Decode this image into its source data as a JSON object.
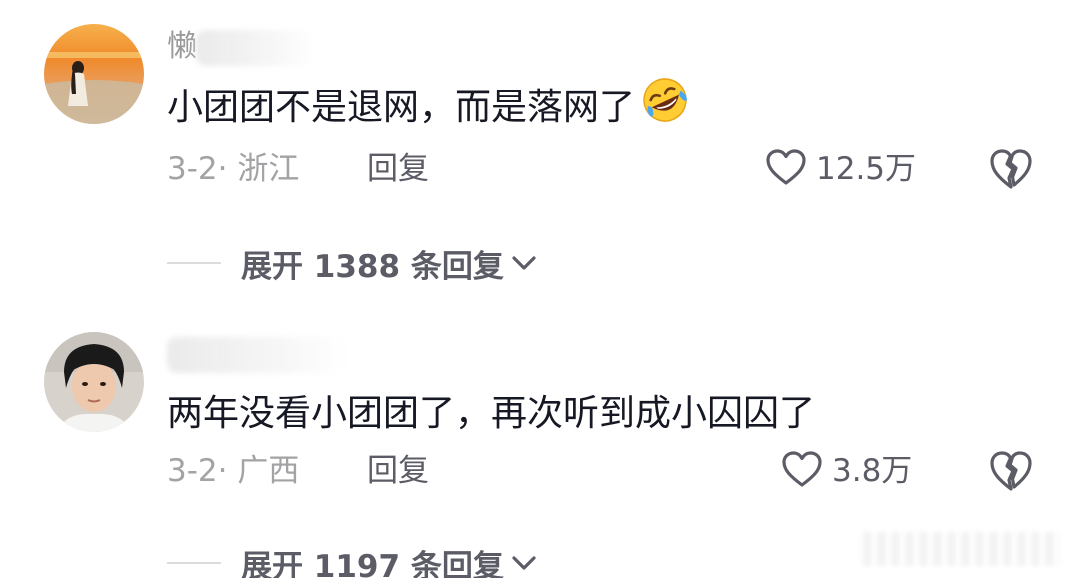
{
  "comments": [
    {
      "username_visible": "懒",
      "text": "小团团不是退网，而是落网了",
      "emoji": "rolling-on-floor-laughing-emoji",
      "date": "3-2",
      "separator": "·",
      "location": "浙江",
      "reply_label": "回复",
      "like_count": "12.5万",
      "expand_label": "展开 1388 条回复"
    },
    {
      "username_visible": "",
      "text": "两年没看小团团了，再次听到成小囚囚了",
      "date": "3-2",
      "separator": "·",
      "location": "广西",
      "reply_label": "回复",
      "like_count": "3.8万",
      "expand_label": "展开 1197 条回复"
    }
  ],
  "colors": {
    "primary_text": "#161823",
    "secondary_text": "#a3a3a6",
    "action_text": "#5b5c66",
    "divider": "#dcdcdc"
  }
}
